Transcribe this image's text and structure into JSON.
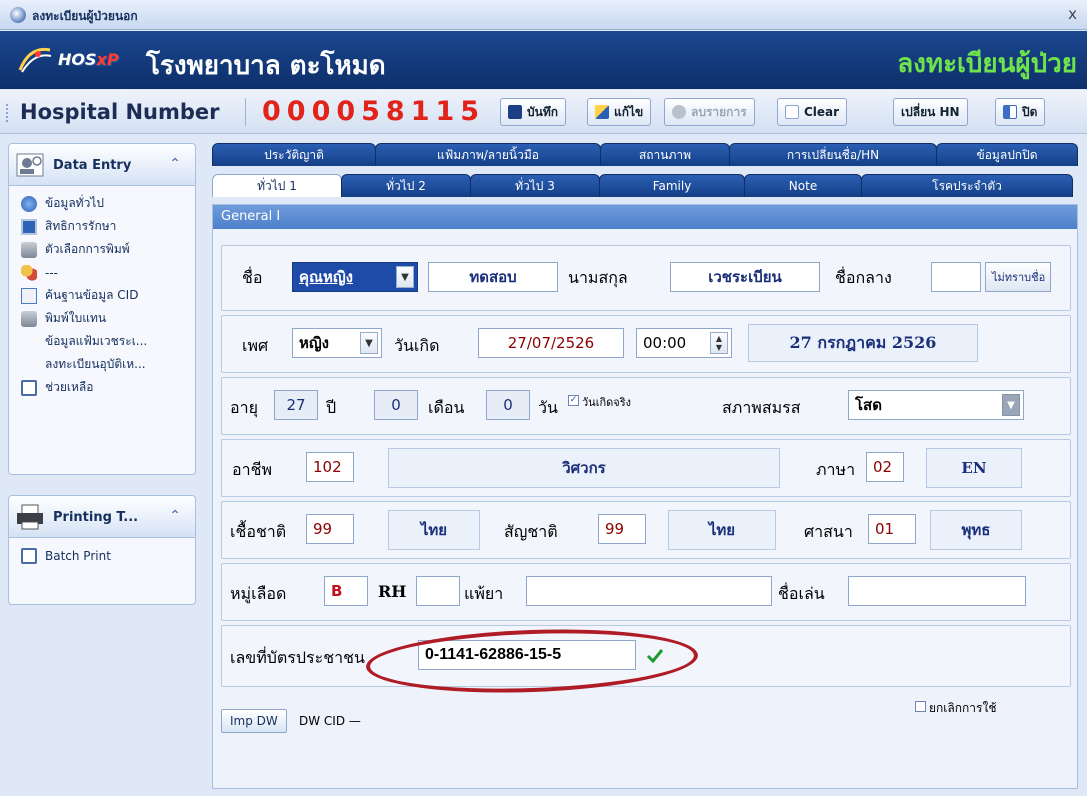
{
  "window": {
    "title": "ลงทะเบียนผู้ป่วยนอก",
    "close_glyph": "x"
  },
  "banner": {
    "logo_text_a": "HOS",
    "logo_text_b": "xP",
    "hospital_name": "โรงพยาบาล ตะโหมด",
    "page_title": "ลงทะเบียนผู้ป่วย"
  },
  "toolbar": {
    "hn_label": "Hospital Number",
    "hn_value": "000058115",
    "save_label": "บันทึก",
    "edit_label": "แก้ไข",
    "cancel_label": "ลบรายการ",
    "clear_label": "Clear",
    "change_hn_label": "เปลี่ยน HN",
    "close_label": "ปิด"
  },
  "sidebar": {
    "data_entry_title": "Data Entry",
    "items": [
      {
        "label": "ข้อมูลทั่วไป",
        "icon": "globe-icon"
      },
      {
        "label": "สิทธิการรักษา",
        "icon": "monitor-icon"
      },
      {
        "label": "ตัวเลือกการพิมพ์",
        "icon": "printer-icon"
      },
      {
        "label": "---",
        "icon": "users-icon"
      },
      {
        "label": "ค้นฐานข้อมูล CID",
        "icon": "database-icon"
      },
      {
        "label": "พิมพ์ใบแทน",
        "icon": "printer-icon"
      },
      {
        "label": "ข้อมูลแฟ้มเวชระเ...",
        "icon": ""
      },
      {
        "label": "ลงทะเบียนอุบัติเห...",
        "icon": ""
      },
      {
        "label": "ช่วยเหลือ",
        "icon": "help-icon"
      }
    ],
    "printing_title": "Printing T...",
    "printing_items": [
      {
        "label": "Batch Print",
        "icon": "print-batch-icon"
      }
    ]
  },
  "tabs_top": [
    "ประวัติญาติ",
    "แฟ้มภาพ/ลายนิ้วมือ",
    "สถานภาพ",
    "การเปลี่ยนชื่อ/HN",
    "ข้อมูลปกปิด"
  ],
  "tabs_bottom": [
    "ทั่วไป 1",
    "ทั่วไป 2",
    "ทั่วไป 3",
    "Family",
    "Note",
    "โรคประจำตัว"
  ],
  "general": {
    "header": "General I",
    "name_label": "ชื่อ",
    "prefix": "คุณหญิง",
    "first_name": "ทดสอบ",
    "surname_label": "นามสกุล",
    "surname": "เวชระเบียน",
    "middle_label": "ชื่อกลาง",
    "middle_value": "",
    "unknown_name_btn": "ไม่ทราบชื่อ",
    "sex_label": "เพศ",
    "sex": "หญิง",
    "dob_label": "วันเกิด",
    "dob": "27/07/2526",
    "dob_time": "00:00",
    "dob_text": "27 กรกฎาคม 2526",
    "age_label": "อายุ",
    "age_years": "27",
    "years_label": "ปี",
    "age_months": "0",
    "months_label": "เดือน",
    "age_days": "0",
    "days_label": "วัน",
    "real_dob_label": "วันเกิดจริง",
    "marital_label": "สภาพสมรส",
    "marital": "โสด",
    "occupation_label": "อาชีพ",
    "occupation_code": "102",
    "occupation_name": "วิศวกร",
    "language_label": "ภาษา",
    "language_code": "02",
    "language_name": "EN",
    "ethnicity_label": "เชื้อชาติ",
    "ethnicity_code": "99",
    "ethnicity_name": "ไทย",
    "nationality_label": "สัญชาติ",
    "nationality_code": "99",
    "nationality_name": "ไทย",
    "religion_label": "ศาสนา",
    "religion_code": "01",
    "religion_name": "พุทธ",
    "blood_label": "หมู่เลือด",
    "blood_value": "B",
    "rh_label": "RH",
    "rh_value": "",
    "allergy_label": "แพ้ยา",
    "allergy_value": "",
    "nickname_label": "ชื่อเล่น",
    "nickname_value": "",
    "cid_label": "เลขที่บัตรประชาชน",
    "cid_value": "0-1141-62886-15-5",
    "cancel_use_label": "ยกเลิกการใช้",
    "imp_dw_label": "Imp DW",
    "dw_cid_label": "DW CID —"
  },
  "colors": {
    "banner": "#103577",
    "hn_red": "#e2231a",
    "title_green": "#6fe34b",
    "highlight_circle": "#b01c25"
  }
}
